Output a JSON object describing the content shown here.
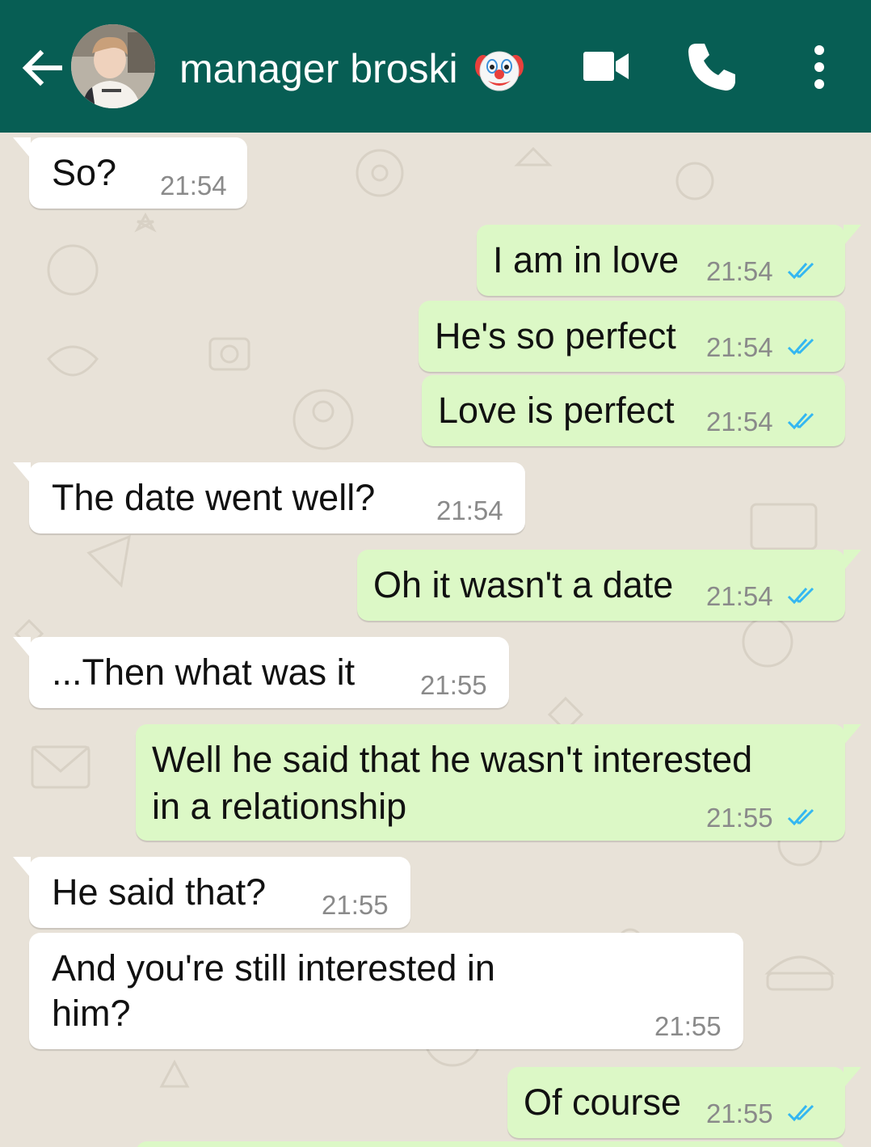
{
  "header": {
    "contact_name": "manager broski",
    "background_color": "#075e54",
    "icons": [
      "back-arrow-icon",
      "avatar",
      "clown-emoji-icon",
      "video-call-icon",
      "voice-call-icon",
      "more-options-icon"
    ]
  },
  "colors": {
    "incoming_bubble": "#ffffff",
    "outgoing_bubble": "#dcf8c6",
    "read_ticks": "#34b7f1",
    "chat_background": "#e8e2d8"
  },
  "messages": [
    {
      "direction": "incoming",
      "text": "So?",
      "time": "21:54"
    },
    {
      "direction": "outgoing",
      "text": "I am in love",
      "time": "21:54",
      "status": "read"
    },
    {
      "direction": "outgoing",
      "text": "He's so perfect",
      "time": "21:54",
      "status": "read"
    },
    {
      "direction": "outgoing",
      "text": "Love is perfect",
      "time": "21:54",
      "status": "read"
    },
    {
      "direction": "incoming",
      "text": "The date went well?",
      "time": "21:54"
    },
    {
      "direction": "outgoing",
      "text": "Oh it wasn't a date",
      "time": "21:54",
      "status": "read"
    },
    {
      "direction": "incoming",
      "text": "...Then what was it",
      "time": "21:55"
    },
    {
      "direction": "outgoing",
      "lines": [
        "Well he said that he wasn't interested",
        "in a relationship"
      ],
      "time": "21:55",
      "status": "read"
    },
    {
      "direction": "incoming",
      "text": "He said that?",
      "time": "21:55"
    },
    {
      "direction": "incoming",
      "lines": [
        "And you're still interested in",
        "him?"
      ],
      "time": "21:55"
    },
    {
      "direction": "outgoing",
      "text": "Of course",
      "time": "21:55",
      "status": "read"
    }
  ]
}
